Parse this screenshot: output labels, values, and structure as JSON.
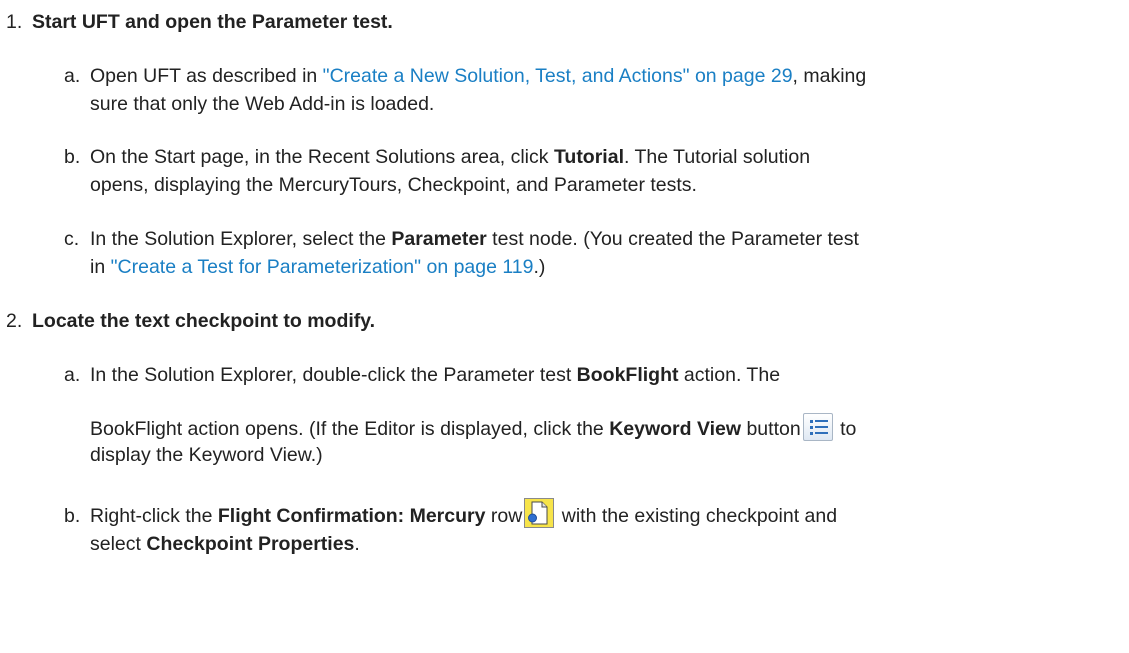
{
  "steps": [
    {
      "number": "1.",
      "title": "Start UFT and open the Parameter test.",
      "substeps": [
        {
          "letter": "a.",
          "text1": "Open UFT as described in ",
          "link": "\"Create a New Solution, Test, and Actions\" on page 29",
          "text2": ", making",
          "line2": "sure that only the Web Add-in is loaded."
        },
        {
          "letter": "b.",
          "text1": "On the Start page, in the Recent Solutions area, click ",
          "bold": "Tutorial",
          "text2": ". The Tutorial solution",
          "line2": "opens, displaying the MercuryTours, Checkpoint, and Parameter tests."
        },
        {
          "letter": "c.",
          "text1": "In the Solution Explorer, select the ",
          "bold": "Parameter",
          "text2": " test node. (You created the Parameter test",
          "line2_pre": "in ",
          "link": "\"Create a Test for Parameterization\" on page 119",
          "line2_post": ".)"
        }
      ]
    },
    {
      "number": "2.",
      "title": "Locate the text checkpoint to modify.",
      "substeps": [
        {
          "letter": "a.",
          "text1": "In the Solution Explorer, double-click the Parameter test ",
          "bold": "BookFlight",
          "text2": " action. The",
          "line2_pre": "BookFlight action opens. (If the Editor is displayed, click the ",
          "line2_bold": "Keyword View",
          "line2_mid": " button",
          "line2_post": " to",
          "line3": "display the Keyword View.)",
          "icon": "keyword-view-icon"
        },
        {
          "letter": "b.",
          "text1": "Right-click the ",
          "bold": "Flight Confirmation: Mercury",
          "text2": " row",
          "text3": " with the existing checkpoint and",
          "line2_pre": "select ",
          "line2_bold": "Checkpoint Properties",
          "line2_post": ".",
          "icon": "page-checkpoint-icon"
        }
      ]
    }
  ]
}
